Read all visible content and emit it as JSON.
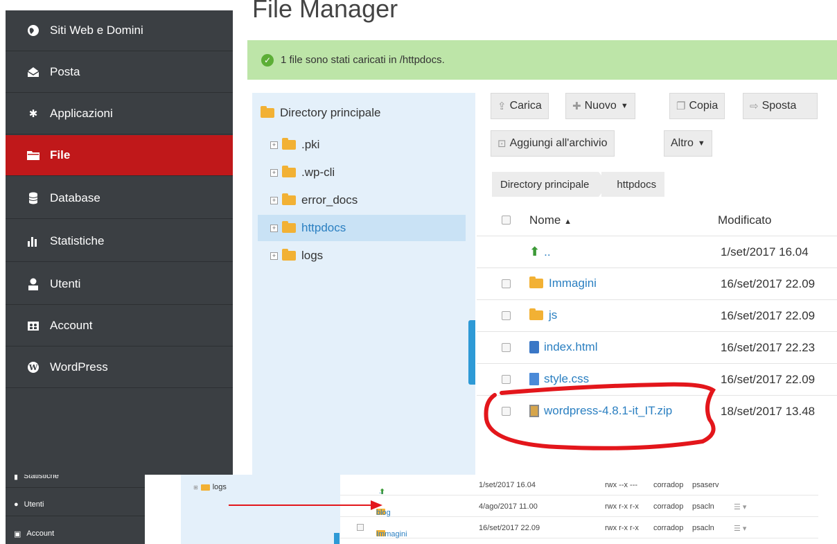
{
  "page_title": "File Manager",
  "alert": {
    "text": "1 file sono stati caricati in /httpdocs."
  },
  "sidebar": {
    "items": [
      {
        "label": "Siti Web e Domini",
        "icon": "globe-icon"
      },
      {
        "label": "Posta",
        "icon": "mail-icon"
      },
      {
        "label": "Applicazioni",
        "icon": "gear-icon"
      },
      {
        "label": "File",
        "icon": "folder-icon",
        "active": true
      },
      {
        "label": "Database",
        "icon": "database-icon"
      },
      {
        "label": "Statistiche",
        "icon": "bar-chart-icon"
      },
      {
        "label": "Utenti",
        "icon": "user-icon"
      },
      {
        "label": "Account",
        "icon": "account-icon"
      },
      {
        "label": "WordPress",
        "icon": "wordpress-icon"
      }
    ]
  },
  "tree": {
    "root": "Directory principale",
    "items": [
      {
        "label": ".pki"
      },
      {
        "label": ".wp-cli"
      },
      {
        "label": "error_docs"
      },
      {
        "label": "httpdocs",
        "selected": true
      },
      {
        "label": "logs"
      }
    ]
  },
  "toolbar": {
    "upload": "Carica",
    "new": "Nuovo",
    "copy": "Copia",
    "move": "Sposta",
    "archive": "Aggiungi all'archivio",
    "more": "Altro"
  },
  "breadcrumb": [
    "Directory principale",
    "httpdocs"
  ],
  "table": {
    "col_name": "Nome",
    "col_modified": "Modificato",
    "rows": [
      {
        "name": "..",
        "modified": "1/set/2017 16.04",
        "type": "up"
      },
      {
        "name": "Immagini",
        "modified": "16/set/2017 22.09",
        "type": "folder"
      },
      {
        "name": "js",
        "modified": "16/set/2017 22.09",
        "type": "folder"
      },
      {
        "name": "index.html",
        "modified": "16/set/2017 22.23",
        "type": "html"
      },
      {
        "name": "style.css",
        "modified": "16/set/2017 22.09",
        "type": "css"
      },
      {
        "name": "wordpress-4.8.1-it_IT.zip",
        "modified": "18/set/2017 13.48",
        "type": "zip"
      }
    ]
  },
  "inset": {
    "sidebar": [
      "Statistiche",
      "Utenti",
      "Account"
    ],
    "tree_item": "logs",
    "rows": [
      {
        "name": "..",
        "modified": "1/set/2017 16.04",
        "perms": "rwx --x ---",
        "owner": "corradop",
        "group": "psaserv"
      },
      {
        "name": "blog",
        "modified": "4/ago/2017 11.00",
        "perms": "rwx r-x r-x",
        "owner": "corradop",
        "group": "psacln"
      },
      {
        "name": "Immagini",
        "modified": "16/set/2017 22.09",
        "perms": "rwx r-x r-x",
        "owner": "corradop",
        "group": "psacln"
      }
    ]
  },
  "colors": {
    "active": "#c0181a",
    "sidebar": "#3b3f43",
    "alert": "#bde5a8",
    "link": "#2a7fc1",
    "annotation": "#e3161b"
  }
}
